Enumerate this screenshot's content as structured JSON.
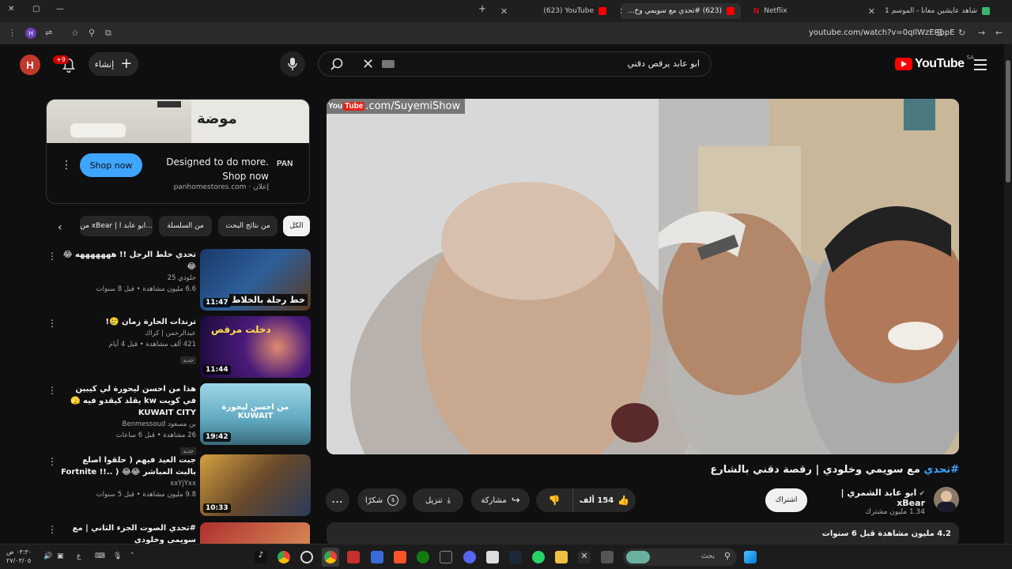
{
  "browser": {
    "tabs": [
      {
        "title": "(623) YouTube",
        "favicon": "youtube-icon"
      },
      {
        "title": "(623) #تحدي مع سويمي وخ...",
        "favicon": "youtube-icon",
        "active": true
      },
      {
        "title": "Netflix",
        "favicon": "netflix-icon"
      },
      {
        "title": "شاهد عايشين معانا - الموسم 1",
        "favicon": "shahid-icon"
      }
    ],
    "new_tab": "+",
    "url": "youtube.com/watch?v=0qIlWzERbpE"
  },
  "header": {
    "avatar_letter": "H",
    "notifications": "+9",
    "create_label": "إنشاء",
    "search_query": "ابو عابد يرقص دقني",
    "logo_text": "YouTube",
    "region": "SA"
  },
  "ad": {
    "brand": "موضة",
    "title": "Designed to do more. Shop now",
    "cta": "Shop now",
    "domain": "panhomestores.com · إعلان",
    "logo": "PAN"
  },
  "chips": [
    "الكل",
    "من نتائج البحث",
    "من السلسلة",
    "من xBear | ابو عابد ا..."
  ],
  "recommendations": [
    {
      "title": "تحدي خلط الرجل !! هههههههه 😂😂",
      "channel": "خلودي 25",
      "meta": "6.6 مليون مشاهدة • قبل 8 سنوات",
      "duration": "11:47",
      "thumb_text": "خط رجلة بالخلاط",
      "new": ""
    },
    {
      "title": "ترندات الحارة زمان 🥲!",
      "channel": "عبدالرحمن | كراك",
      "meta": "421 ألف مشاهدة • قبل 4 أيام",
      "duration": "11:44",
      "thumb_text": "دخلت مرقص",
      "new": "جديد"
    },
    {
      "title": "هذا من احسن ليحورة لي كيبين في كويت kw يقلد كيقدو فيه 🫣 KUWAIT CITY",
      "channel": "بن مسعود Benmessoud",
      "meta": "26 مشاهدة • قبل 6 ساعات",
      "duration": "19:42",
      "thumb_text": "من احسن ليحورة KUWAIT",
      "new": "جديد"
    },
    {
      "title": "جبت العيد فيهم ( حلقوا اصلع بالبث المباشر 😂😂 ( ..!! Fortnite",
      "channel": "xxYjYxx",
      "meta": "9.8 مليون مشاهدة • قبل 5 سنوات",
      "duration": "10:33",
      "thumb_text": "",
      "new": ""
    },
    {
      "title": "#تحدي الصوت الجزء الثاني | مع سويمي وخلودي",
      "channel": "",
      "meta": "",
      "duration": "",
      "thumb_text": "",
      "new": ""
    }
  ],
  "video": {
    "watermark": ".com/SuyemiShow",
    "title_tag": "#تحدي",
    "title_rest": " مع سويمي وخلودي | رقصة دقني بالشارع",
    "channel_name": "ابو عابد الشمري | xBear",
    "subscribers": "1.34 مليون مشترك",
    "subscribe_label": "اشتراك",
    "likes": "154 ألف",
    "share_label": "مشاركة",
    "download_label": "تنزيل",
    "thanks_label": "شكرًا",
    "more": "...",
    "desc_meta": "4.2 مليون مشاهدة  قبل 6 سنوات"
  },
  "taskbar": {
    "search_placeholder": "بحث",
    "time": "٠٣:٣٠ ص",
    "date": "٢٧/٠٣/٠٥",
    "lang": "ع"
  }
}
